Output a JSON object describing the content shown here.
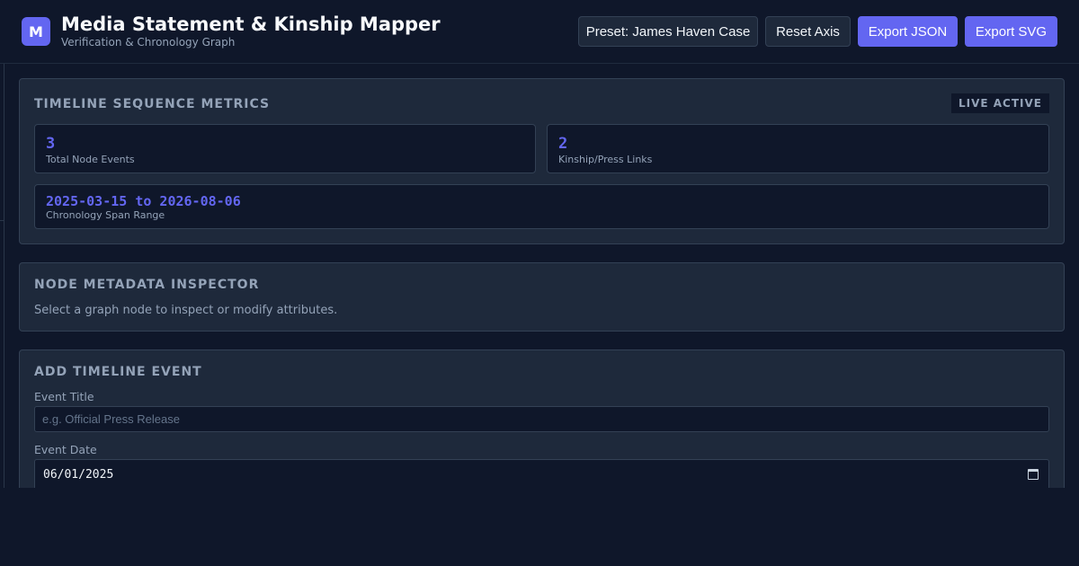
{
  "header": {
    "logo_letter": "M",
    "title": "Media Statement & Kinship Mapper",
    "subtitle": "Verification & Chronology Graph",
    "buttons": {
      "preset": "Preset: James Haven Case",
      "reset": "Reset Axis",
      "export_json": "Export JSON",
      "export_svg": "Export SVG"
    }
  },
  "metrics": {
    "title": "TIMELINE SEQUENCE METRICS",
    "badge": "LIVE ACTIVE",
    "total_events": {
      "value": "3",
      "label": "Total Node Events"
    },
    "links": {
      "value": "2",
      "label": "Kinship/Press Links"
    },
    "span": {
      "value": "2025-03-15 to 2026-08-06",
      "label": "Chronology Span Range"
    }
  },
  "inspector": {
    "title": "NODE METADATA INSPECTOR",
    "hint": "Select a graph node to inspect or modify attributes."
  },
  "add_event": {
    "title": "ADD TIMELINE EVENT",
    "event_title_label": "Event Title",
    "event_title_value": "",
    "event_title_placeholder": "e.g. Official Press Release",
    "event_date_label": "Event Date",
    "event_date_value": "06/01/2025"
  },
  "colors": {
    "background": "#0f172a",
    "panel": "#1e293b",
    "border": "#334155",
    "accent": "#6366f1",
    "muted_text": "#94a3b8"
  },
  "icons": {
    "logo": "app-logo-icon",
    "date_picker": "calendar-icon"
  }
}
